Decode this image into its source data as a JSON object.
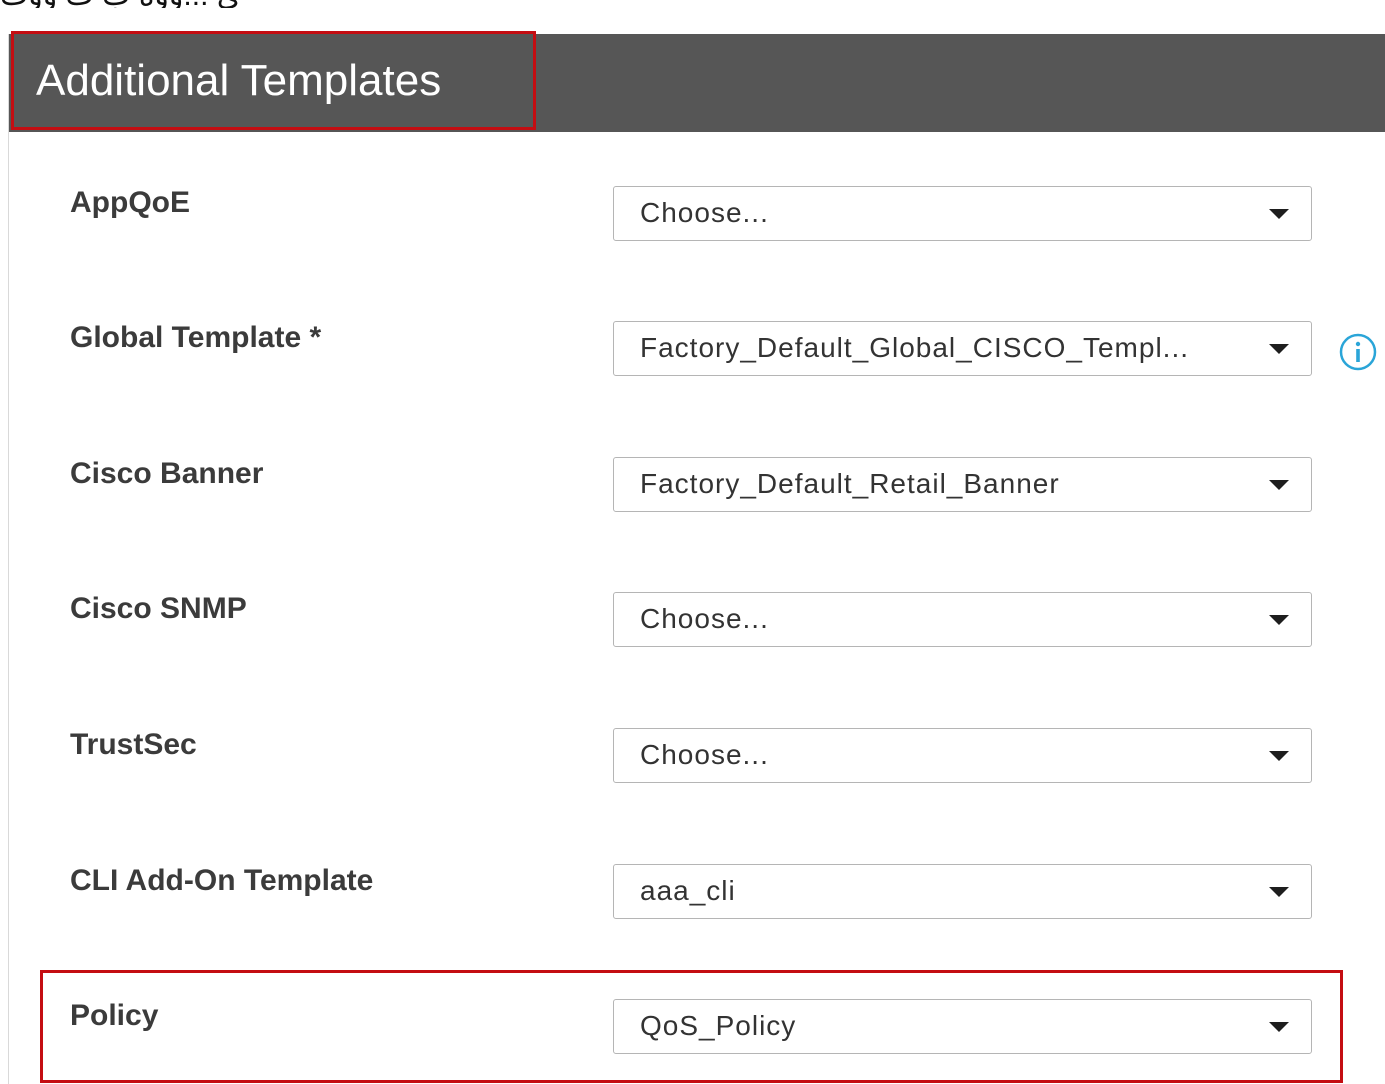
{
  "top_fragment": "ي ...وۈه ب ت ووت",
  "header": {
    "title": "Additional Templates"
  },
  "rows": [
    {
      "label": "AppQoE",
      "value": "Choose..."
    },
    {
      "label": "Global Template *",
      "value": "Factory_Default_Global_CISCO_Templ..."
    },
    {
      "label": "Cisco Banner",
      "value": "Factory_Default_Retail_Banner"
    },
    {
      "label": "Cisco SNMP",
      "value": "Choose..."
    },
    {
      "label": "TrustSec",
      "value": "Choose..."
    },
    {
      "label": "CLI Add-On Template",
      "value": "aaa_cli"
    },
    {
      "label": "Policy",
      "value": "QoS_Policy"
    }
  ],
  "icons": {
    "dropdown_caret": "chevron-down-icon",
    "info": "info-icon"
  },
  "colors": {
    "header_bg": "#565656",
    "highlight_border": "#c40d12",
    "info_icon": "#2aa5d8",
    "label_text": "#3b3b3b"
  }
}
